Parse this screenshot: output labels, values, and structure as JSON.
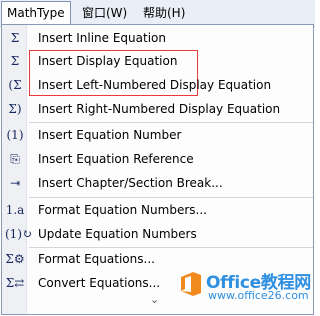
{
  "menubar": {
    "items": [
      {
        "label": "MathType"
      },
      {
        "label": "窗口(W)"
      },
      {
        "label": "帮助(H)"
      }
    ]
  },
  "menu": {
    "items": [
      {
        "icon_glyph": "Σ",
        "icon": "sigma-inline-icon",
        "label": "Insert Inline Equation"
      },
      {
        "icon_glyph": "Σ",
        "icon": "sigma-display-icon",
        "label": "Insert Display Equation"
      },
      {
        "icon_glyph": "(Σ",
        "icon": "sigma-left-numbered-icon",
        "label": "Insert Left-Numbered Display Equation"
      },
      {
        "icon_glyph": "Σ)",
        "icon": "sigma-right-numbered-icon",
        "label": "Insert Right-Numbered Display Equation"
      },
      {
        "icon_glyph": "(1)",
        "icon": "equation-number-icon",
        "label": "Insert Equation Number"
      },
      {
        "icon_glyph": "⎘",
        "icon": "equation-reference-icon",
        "label": "Insert Equation Reference"
      },
      {
        "icon_glyph": "⇥",
        "icon": "section-break-icon",
        "label": "Insert Chapter/Section Break..."
      },
      {
        "icon_glyph": "1.a",
        "icon": "format-numbers-icon",
        "label": "Format Equation Numbers..."
      },
      {
        "icon_glyph": "(1)↻",
        "icon": "update-numbers-icon",
        "label": "Update Equation Numbers"
      },
      {
        "icon_glyph": "Σ⚙",
        "icon": "format-equations-icon",
        "label": "Format Equations..."
      },
      {
        "icon_glyph": "Σ⇄",
        "icon": "convert-equations-icon",
        "label": "Convert Equations..."
      }
    ],
    "more_glyph": "⌄"
  },
  "watermark": {
    "main": "Office教程网",
    "sub": "www.office26.com"
  },
  "colors": {
    "highlight_box": "#e83a3a",
    "watermark": "#2f8fe0",
    "menubar_bg": "#e9eef7"
  }
}
